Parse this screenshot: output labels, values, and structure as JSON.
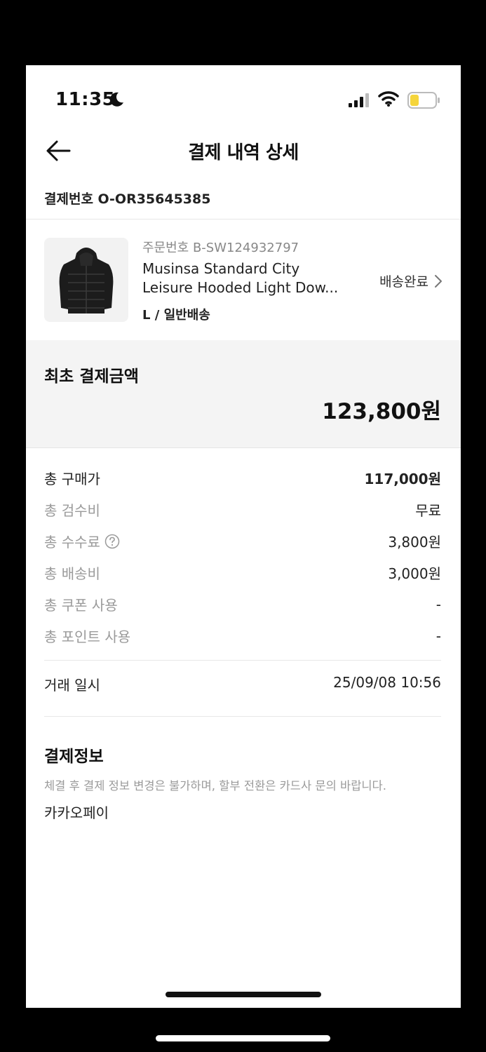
{
  "status_bar": {
    "time": "11:35"
  },
  "nav": {
    "title": "결제 내역 상세"
  },
  "payment": {
    "number_label": "결제번호 O-OR35645385"
  },
  "product": {
    "order_no": "주문번호 B-SW124932797",
    "name_line1": "Musinsa Standard City",
    "name_line2": "Leisure Hooded Light Dow...",
    "option": "L / 일반배송",
    "status": "배송완료"
  },
  "amount": {
    "label": "최초 결제금액",
    "value": "123,800원"
  },
  "breakdown": [
    {
      "label": "총 구매가",
      "value": "117,000원"
    },
    {
      "label": "총 검수비",
      "value": "무료"
    },
    {
      "label": "총 수수료",
      "value": "3,800원"
    },
    {
      "label": "총 배송비",
      "value": "3,000원"
    },
    {
      "label": "총 쿠폰 사용",
      "value": "-"
    },
    {
      "label": "총 포인트 사용",
      "value": "-"
    }
  ],
  "transaction": {
    "label": "거래 일시",
    "value": "25/09/08 10:56"
  },
  "payment_info": {
    "title": "결제정보",
    "notice": "체결 후 결제 정보 변경은 불가하며, 할부 전환은 카드사 문의 바랍니다.",
    "method": "카카오페이"
  },
  "colors": {
    "accent_battery": "#f5d53b",
    "muted_text": "#9a9a9a",
    "section_bg": "#f4f4f4"
  },
  "icons": [
    "moon-icon",
    "signal-icon",
    "wifi-icon",
    "battery-icon",
    "back-arrow-icon",
    "chevron-right-icon",
    "help-icon"
  ]
}
